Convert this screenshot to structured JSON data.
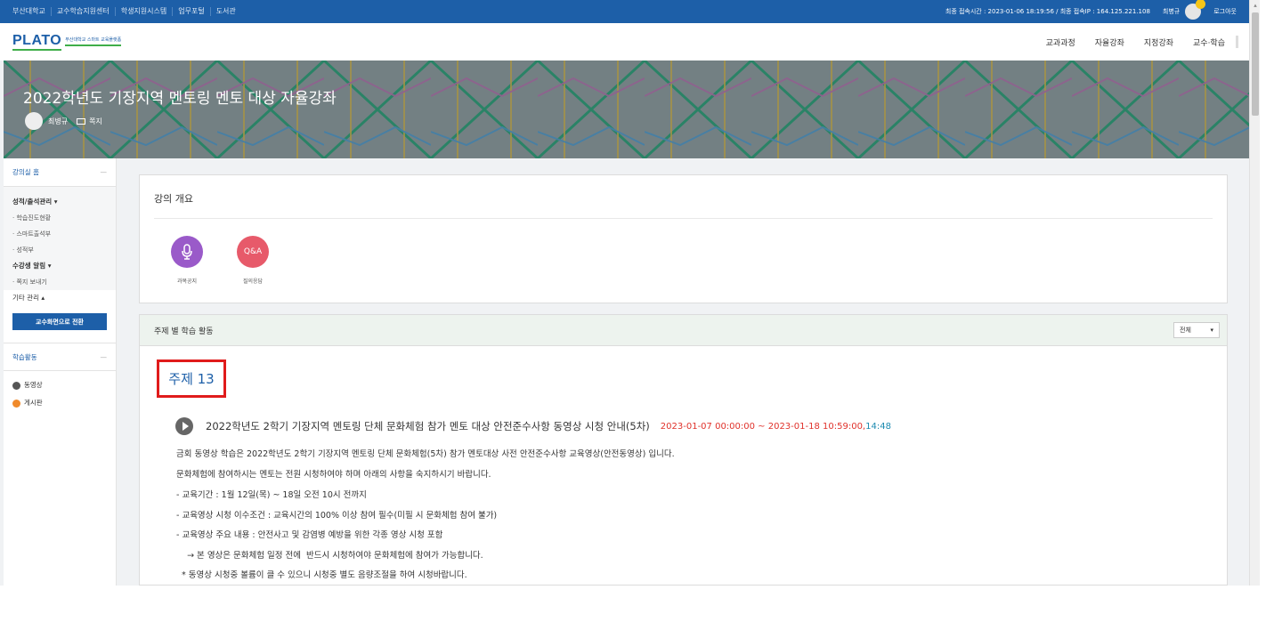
{
  "topbar": {
    "links": [
      "부산대학교",
      "교수학습지원센터",
      "학생지원시스템",
      "업무포털",
      "도서관"
    ],
    "login_info": "최종 접속시간 : 2023-01-06 18:19:56 / 최종 접속IP : 164.125.221.108",
    "user_name": "최병규",
    "logout": "로그아웃"
  },
  "nav": {
    "logo": "PLATO",
    "logo_sub": "부산대학교 스마트 교육플랫폼",
    "menu": [
      "교과과정",
      "자율강좌",
      "지정강좌",
      "교수·학습"
    ]
  },
  "banner": {
    "title": "2022학년도 기장지역 멘토링 멘토 대상 자율강좌",
    "instructor": "최병규",
    "message": "쪽지"
  },
  "sidebar": {
    "home": "강의실 홈",
    "grades_group": "성적/출석관리 ▾",
    "grades_items": [
      "· 학습진도현황",
      "· 스마트출석부",
      "· 성적부"
    ],
    "notify_group": "수강생 알림 ▾",
    "notify_items": [
      "· 쪽지 보내기"
    ],
    "etc_group": "기타 관리 ▴",
    "switch_button": "교수화면으로 전환",
    "activities_head": "학습활동",
    "activities": [
      "동영상",
      "게시판"
    ]
  },
  "overview": {
    "title": "강의 개요",
    "icons": [
      {
        "label": "과목공지",
        "icon": "microphone-icon",
        "color": "#9a5ac9"
      },
      {
        "label": "질의응답",
        "text": "Q&A",
        "icon": "qna-icon",
        "color": "#e75a6a"
      }
    ]
  },
  "weekly": {
    "title": "주제 별 학습 활동",
    "filter": "전체",
    "topic": "주제 13",
    "activity": {
      "title": "2022학년도 2학기 기장지역 멘토링 단체 문화체험 참가 멘토 대상 안전준수사항 동영상 시청 안내(5차)",
      "period": "2023-01-07 00:00:00 ~ 2023-01-18 10:59:00,",
      "duration": "14:48"
    },
    "description": [
      "금회 동영상 학습은 2022학년도 2학기 기장지역 멘토링  단체 문화체험(5차) 참가 멘토대상 사전 안전준수사항 교육영상(안전동영상) 입니다.",
      "문화체험에 참여하시는 멘토는 전원 시청하여야 하며 아래의 사항을 숙지하시기 바랍니다.",
      "- 교육기간 : 1월 12일(목) ~ 18일  오전 10시 전까지",
      "- 교육영상 시청 이수조건 : 교육시간의 100% 이상 참여 필수(미필 시 문화체험 참여 불가)",
      "- 교육영상 주요 내용 : 안전사고 및 감염병 예방을 위한 각종 영상 시청 포함",
      "    → 본 영상은 문화체험 일정 전에  반드시 시청하여야 문화체험에 참여가 가능합니다.",
      "* 동영상 시청중 볼륨이 클 수 있으니 시청중 별도 음량조절을 하여 시청바랍니다."
    ]
  },
  "colors": {
    "primary": "#1d5fa8",
    "highlight": "#e01b1b",
    "period": "#e0322b",
    "duration": "#1d8bb0"
  }
}
